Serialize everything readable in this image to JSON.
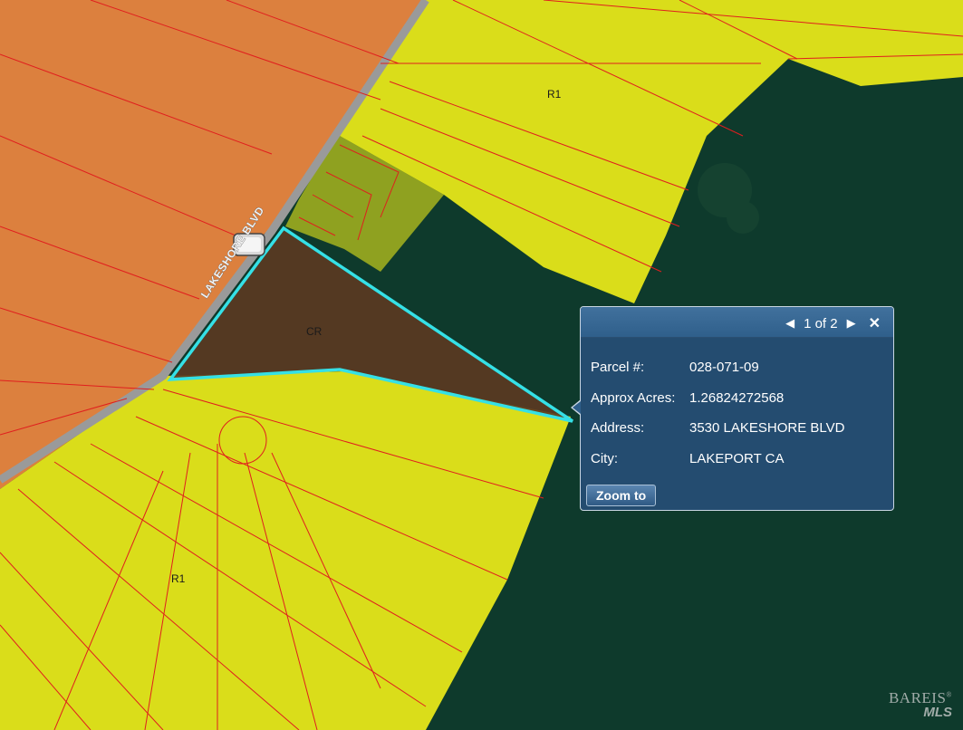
{
  "map": {
    "zones": [
      {
        "label": "R1"
      },
      {
        "label": "CR"
      },
      {
        "label": "R1"
      }
    ],
    "road_label": "LAKESHORE BLVD",
    "colors": {
      "water": "#0e3a2c",
      "commercial_zone": "#e8843f",
      "residential_zone": "#e6e619",
      "selected_parcel": "#5a3a22",
      "parcel_outline": "#e01e1e",
      "selection_outline": "#35e0e6",
      "road": "#9a9a9a"
    }
  },
  "popup": {
    "pager": {
      "text": "1 of 2",
      "prev_icon": "triangle-left-icon",
      "next_icon": "triangle-right-icon",
      "close_icon": "close-icon"
    },
    "fields": [
      {
        "label": "Parcel #:",
        "value": "028-071-09"
      },
      {
        "label": "Approx Acres:",
        "value": "1.26824272568"
      },
      {
        "label": "Address:",
        "value": "3530 LAKESHORE BLVD"
      },
      {
        "label": "City:",
        "value": "LAKEPORT CA"
      }
    ],
    "zoom_button": "Zoom to"
  },
  "watermark": {
    "line1": "BAREIS",
    "line2": "MLS",
    "mark": "®"
  }
}
